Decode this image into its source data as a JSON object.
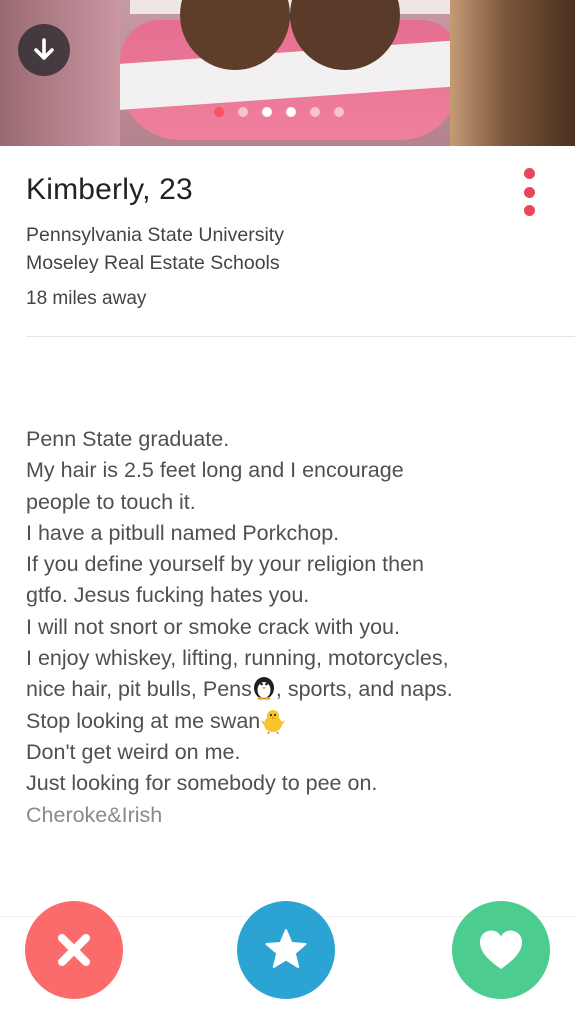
{
  "profile": {
    "name_age": "Kimberly, 23",
    "schools": [
      "Pennsylvania State University",
      "Moseley Real Estate Schools"
    ],
    "distance": "18 miles away"
  },
  "photo": {
    "dot_count": 6,
    "active_index": 0
  },
  "bio": {
    "lines": [
      "Penn State graduate.",
      "My hair is 2.5 feet long and I encourage",
      "people to touch it.",
      "I have a pitbull named Porkchop.",
      "If you define yourself by your religion then",
      "gtfo. Jesus fucking hates you.",
      "I will not snort or smoke crack with you.",
      "I enjoy whiskey, lifting, running, motorcycles,",
      "nice hair, pit bulls, Pens",
      ", sports, and naps.",
      "Stop looking at me swan",
      "Don't get weird on me.",
      "Just looking for somebody to pee on.",
      "Cheroke&Irish"
    ]
  },
  "icons": {
    "download": "arrow-down-icon",
    "menu": "more-vertical-icon",
    "nope": "close-icon",
    "super_like": "star-icon",
    "like": "heart-icon",
    "penguin_emoji": "penguin-icon",
    "chick_emoji": "chick-icon"
  },
  "colors": {
    "accent": "#e8465b",
    "nope": "#fb6b6b",
    "super_like": "#2ba4d4",
    "like": "#4ccd8f"
  }
}
